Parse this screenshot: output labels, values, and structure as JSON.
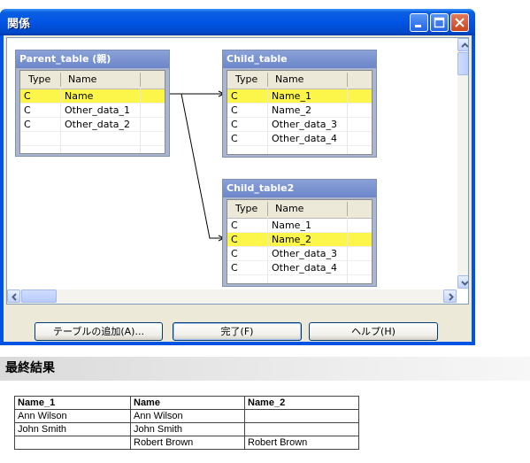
{
  "window": {
    "title": "関係"
  },
  "parent_table": {
    "title": "Parent_table (親)",
    "columns": [
      "Type",
      "Name"
    ],
    "rows": [
      {
        "type": "C",
        "name": "Name"
      },
      {
        "type": "C",
        "name": "Other_data_1"
      },
      {
        "type": "C",
        "name": "Other_data_2"
      }
    ]
  },
  "child_table": {
    "title": "Child_table",
    "columns": [
      "Type",
      "Name"
    ],
    "rows": [
      {
        "type": "C",
        "name": "Name_1"
      },
      {
        "type": "C",
        "name": "Name_2"
      },
      {
        "type": "C",
        "name": "Other_data_3"
      },
      {
        "type": "C",
        "name": "Other_data_4"
      }
    ]
  },
  "child_table2": {
    "title": "Child_table2",
    "columns": [
      "Type",
      "Name"
    ],
    "rows": [
      {
        "type": "C",
        "name": "Name_1"
      },
      {
        "type": "C",
        "name": "Name_2"
      },
      {
        "type": "C",
        "name": "Other_data_3"
      },
      {
        "type": "C",
        "name": "Other_data_4"
      }
    ]
  },
  "buttons": {
    "add_table": "テーブルの追加(A)...",
    "done": "完了(F)",
    "help": "ヘルプ(H)"
  },
  "result": {
    "heading": "最終結果",
    "headers": [
      "Name_1",
      "Name",
      "Name_2"
    ],
    "rows": [
      [
        "Ann Wilson",
        "Ann Wilson",
        ""
      ],
      [
        "John Smith",
        "John Smith",
        ""
      ],
      [
        "",
        "Robert Brown",
        "Robert Brown"
      ]
    ]
  },
  "colors": {
    "highlight": "#fcf64a",
    "title_bar": "#0055e5",
    "table_header": "#7890cf"
  }
}
